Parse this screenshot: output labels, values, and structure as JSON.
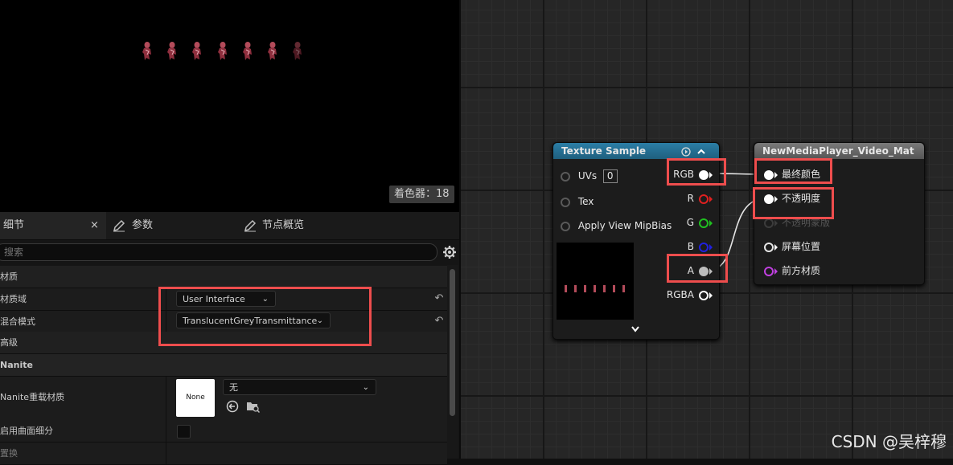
{
  "preview": {
    "shader_count_label": "着色器：18",
    "sprite_count": 7
  },
  "details": {
    "tabs": [
      {
        "label": "细节",
        "close": "×",
        "active": true
      },
      {
        "label": "参数",
        "active": false
      },
      {
        "label": "节点概览",
        "active": false
      }
    ],
    "search_placeholder": "搜索",
    "rows": {
      "material_category": "材质",
      "material_domain_label": "材质域",
      "material_domain_value": "User Interface",
      "blend_mode_label": "混合模式",
      "blend_mode_value": "TranslucentGreyTransmittance",
      "advanced_label": "高级",
      "nanite_category": "Nanite",
      "nanite_override_label": "Nanite重载材质",
      "nanite_thumb_label": "None",
      "nanite_override_value": "无",
      "tessellation_label": "启用曲面细分",
      "displacement_label": "置换"
    }
  },
  "graph": {
    "texture_node": {
      "title": "Texture Sample",
      "header_color": "#1f5f7e",
      "inputs": [
        {
          "label": "UVs",
          "value": "0"
        },
        {
          "label": "Tex"
        },
        {
          "label": "Apply View MipBias"
        }
      ],
      "outputs": [
        {
          "label": "RGB",
          "color": "#ffffff"
        },
        {
          "label": "R",
          "color": "#e02020"
        },
        {
          "label": "G",
          "color": "#20c020"
        },
        {
          "label": "B",
          "color": "#2020e0"
        },
        {
          "label": "A",
          "color": "#bdbdbd"
        },
        {
          "label": "RGBA",
          "color": "#ffffff"
        }
      ]
    },
    "material_node": {
      "title": "NewMediaPlayer_Video_Mat",
      "header_color": "#6a6a6a",
      "inputs": [
        {
          "label": "最终颜色",
          "state": "connected"
        },
        {
          "label": "不透明度",
          "state": "connected"
        },
        {
          "label": "不透明蒙版",
          "state": "disabled"
        },
        {
          "label": "屏幕位置",
          "state": "open"
        },
        {
          "label": "前方材质",
          "state": "material",
          "color": "#c040e0"
        }
      ]
    }
  },
  "watermark": "CSDN @吴梓穆"
}
